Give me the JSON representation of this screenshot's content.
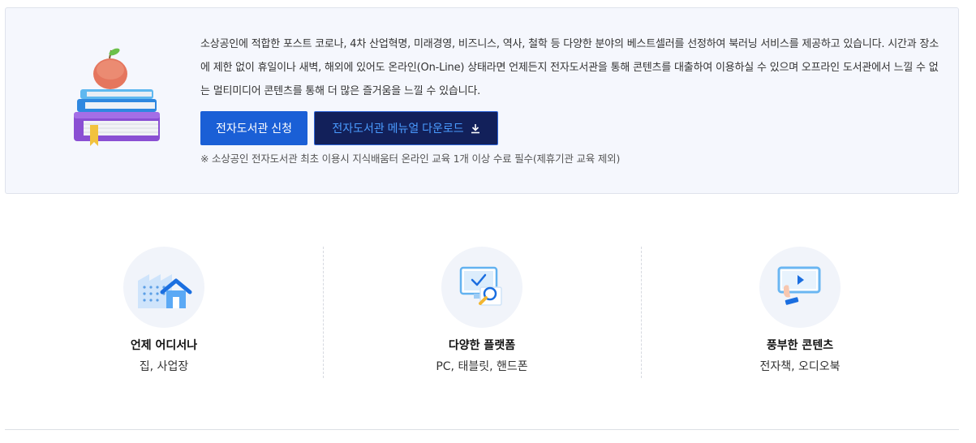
{
  "intro": {
    "description": "소상공인에 적합한 포스트 코로나, 4차 산업혁명, 미래경영, 비즈니스, 역사, 철학 등 다양한 분야의 베스트셀러를 선정하여 북러닝 서비스를 제공하고 있습니다. 시간과 장소에 제한 없이 휴일이나 새벽, 해외에 있어도 온라인(On-Line) 상태라면 언제든지 전자도서관을 통해 콘텐츠를 대출하여 이용하실 수 있으며 오프라인 도서관에서 느낄 수 없는 멀티미디어 콘텐츠를 통해 더 많은 즐거움을 느낄 수 있습니다.",
    "apply_button": "전자도서관 신청",
    "manual_button": "전자도서관 메뉴얼 다운로드",
    "manual_icon": "download-icon",
    "note": "※ 소상공인 전자도서관 최초 이용시 지식배움터 온라인 교육 1개 이상 수료 필수(제휴기관 교육 제외)",
    "illustration": "books-with-apple-illustration"
  },
  "features": [
    {
      "icon": "buildings-home-icon",
      "title": "언제 어디서나",
      "desc": "집, 사업장"
    },
    {
      "icon": "monitor-search-icon",
      "title": "다양한 플랫폼",
      "desc": "PC, 태블릿, 핸드폰"
    },
    {
      "icon": "video-player-hand-icon",
      "title": "풍부한 콘텐츠",
      "desc": "전자책, 오디오북"
    }
  ],
  "colors": {
    "primary": "#1a5fd6",
    "manual_bg": "#12205a",
    "manual_text": "#4a9bff",
    "box_bg": "#f5f7fd"
  }
}
